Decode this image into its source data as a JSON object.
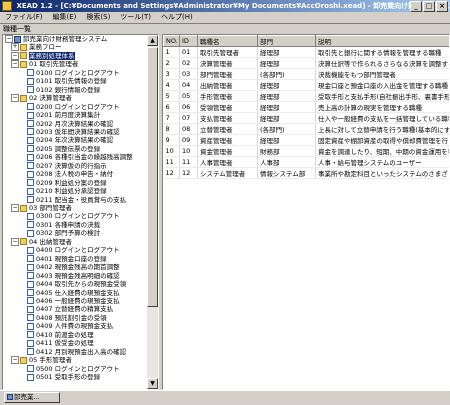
{
  "window": {
    "title": "XEAD 1.2 - [C:¥Documents and Settings¥Administrator¥My Documents¥AccOroshi.xead] - 卸売業向け財務管理システム",
    "buttons": {
      "minimize": "_",
      "maximize": "□",
      "close": "×"
    }
  },
  "menu": [
    "ファイル(F)",
    "編集(E)",
    "検索(S)",
    "ツール(T)",
    "ヘルプ(H)"
  ],
  "tree_header": "職種一覧",
  "tree": [
    {
      "text": "卸売業向け財務管理システム",
      "level": 0,
      "expander": "−",
      "icon": "root"
    },
    {
      "text": "業務フロー",
      "level": 1,
      "expander": "+",
      "icon": "folder"
    },
    {
      "text": "業務別処理体系",
      "level": 1,
      "expander": "−",
      "icon": "folder",
      "selected": true
    },
    {
      "text": "01 取引先管理者",
      "level": 2,
      "expander": "−",
      "icon": "folder"
    },
    {
      "text": "0100 ログインとログアウト",
      "level": 3,
      "icon": "doc"
    },
    {
      "text": "0101 取引先情報の登録",
      "level": 3,
      "icon": "doc"
    },
    {
      "text": "0102 銀行情報の登録",
      "level": 3,
      "icon": "doc"
    },
    {
      "text": "02 決算管理者",
      "level": 2,
      "expander": "−",
      "icon": "folder"
    },
    {
      "text": "0200 ログインとログアウト",
      "level": 3,
      "icon": "doc"
    },
    {
      "text": "0201 前月度決算集計",
      "level": 3,
      "icon": "doc"
    },
    {
      "text": "0202 月次決算結果の確認",
      "level": 3,
      "icon": "doc"
    },
    {
      "text": "0203 仮年間決算結果の確認",
      "level": 3,
      "icon": "doc"
    },
    {
      "text": "0204 年次決算結果の確認",
      "level": 3,
      "icon": "doc"
    },
    {
      "text": "0205 調整伝票の登録",
      "level": 3,
      "icon": "doc"
    },
    {
      "text": "0206 各種引当金の繰越残高調整",
      "level": 3,
      "icon": "doc"
    },
    {
      "text": "0207 決算仮の的行指示",
      "level": 3,
      "icon": "doc"
    },
    {
      "text": "0208 法人税の申告・納付",
      "level": 3,
      "icon": "doc"
    },
    {
      "text": "0209 利益処分案の登録",
      "level": 3,
      "icon": "doc"
    },
    {
      "text": "0210 利益処分承認登録",
      "level": 3,
      "icon": "doc"
    },
    {
      "text": "0211 配当金・役員賞与の支払",
      "level": 3,
      "icon": "doc"
    },
    {
      "text": "03 部門管理者",
      "level": 2,
      "expander": "−",
      "icon": "folder"
    },
    {
      "text": "0300 ログインとログアウト",
      "level": 3,
      "icon": "doc"
    },
    {
      "text": "0301 各種申請の決裁",
      "level": 3,
      "icon": "doc"
    },
    {
      "text": "0302 部門予算の検討",
      "level": 3,
      "icon": "doc"
    },
    {
      "text": "04 出納管理者",
      "level": 2,
      "expander": "−",
      "icon": "folder"
    },
    {
      "text": "0400 ログインとログアウト",
      "level": 3,
      "icon": "doc"
    },
    {
      "text": "0401 現預金口座の登録",
      "level": 3,
      "icon": "doc"
    },
    {
      "text": "0402 現預金残高の期首調整",
      "level": 3,
      "icon": "doc"
    },
    {
      "text": "0403 現預金残高明細の確認",
      "level": 3,
      "icon": "doc"
    },
    {
      "text": "0404 取引先からの現預金受領",
      "level": 3,
      "icon": "doc"
    },
    {
      "text": "0405 仕入経費の現預金支払",
      "level": 3,
      "icon": "doc"
    },
    {
      "text": "0406 一般経費の現預金支払",
      "level": 3,
      "icon": "doc"
    },
    {
      "text": "0407 立替経費の精算支払",
      "level": 3,
      "icon": "doc"
    },
    {
      "text": "0408 預託割引金の受領",
      "level": 3,
      "icon": "doc"
    },
    {
      "text": "0409 人件費の現預金支払",
      "level": 3,
      "icon": "doc"
    },
    {
      "text": "0410 前渡金の処理",
      "level": 3,
      "icon": "doc"
    },
    {
      "text": "0411 仮受金の処理",
      "level": 3,
      "icon": "doc"
    },
    {
      "text": "0412 月別現預金出入高の確認",
      "level": 3,
      "icon": "doc"
    },
    {
      "text": "05 手形管理者",
      "level": 2,
      "expander": "−",
      "icon": "folder"
    },
    {
      "text": "0500 ログインとログアウト",
      "level": 3,
      "icon": "doc"
    },
    {
      "text": "0501 受取手形の登録",
      "level": 3,
      "icon": "doc"
    }
  ],
  "table": {
    "columns": [
      "NO.",
      "ID",
      "職種名",
      "部門",
      "説明"
    ],
    "rows": [
      [
        "1",
        "01",
        "取引先管理者",
        "経理部",
        "取引先と銀行に関する情報を管理する職種"
      ],
      [
        "2",
        "02",
        "決算管理者",
        "経理部",
        "決算仕訳等で作られるさらなる決算を調整するなど"
      ],
      [
        "3",
        "03",
        "部門管理者",
        "(各部門)",
        "決裁機能をもつ部門管理者"
      ],
      [
        "4",
        "04",
        "出納管理者",
        "経理部",
        "現金口座と預金口座の入出金を管理する職種"
      ],
      [
        "5",
        "05",
        "手形管理者",
        "経理部",
        "受取手形と支払手形(自社振出手形、裏書手形)"
      ],
      [
        "6",
        "06",
        "受領管理者",
        "経理部",
        "売上高の計算の現実を管理する職種"
      ],
      [
        "7",
        "07",
        "支払管理者",
        "経理部",
        "仕入や一般経費の支払を一括管理している職種"
      ],
      [
        "8",
        "08",
        "立替管理者",
        "(各部門)",
        "上長に対して立替申請を行う職種(基本的にすべて)"
      ],
      [
        "9",
        "09",
        "資産管理者",
        "経理部",
        "固定資産や棚卸資産の取得や償却費管理を行う"
      ],
      [
        "10",
        "10",
        "資金管理者",
        "財務部",
        "資金を調達したり、短期、中期の資金運用を行う"
      ],
      [
        "11",
        "11",
        "人事管理者",
        "人事部",
        "人事・給与管理システムのユーザー"
      ],
      [
        "12",
        "12",
        "システム管理者",
        "情報システム部",
        "事業所や勘定科目といったシステムのさまざまなマスタを管理"
      ]
    ]
  },
  "status": {
    "tab_label": "卸売業..."
  }
}
